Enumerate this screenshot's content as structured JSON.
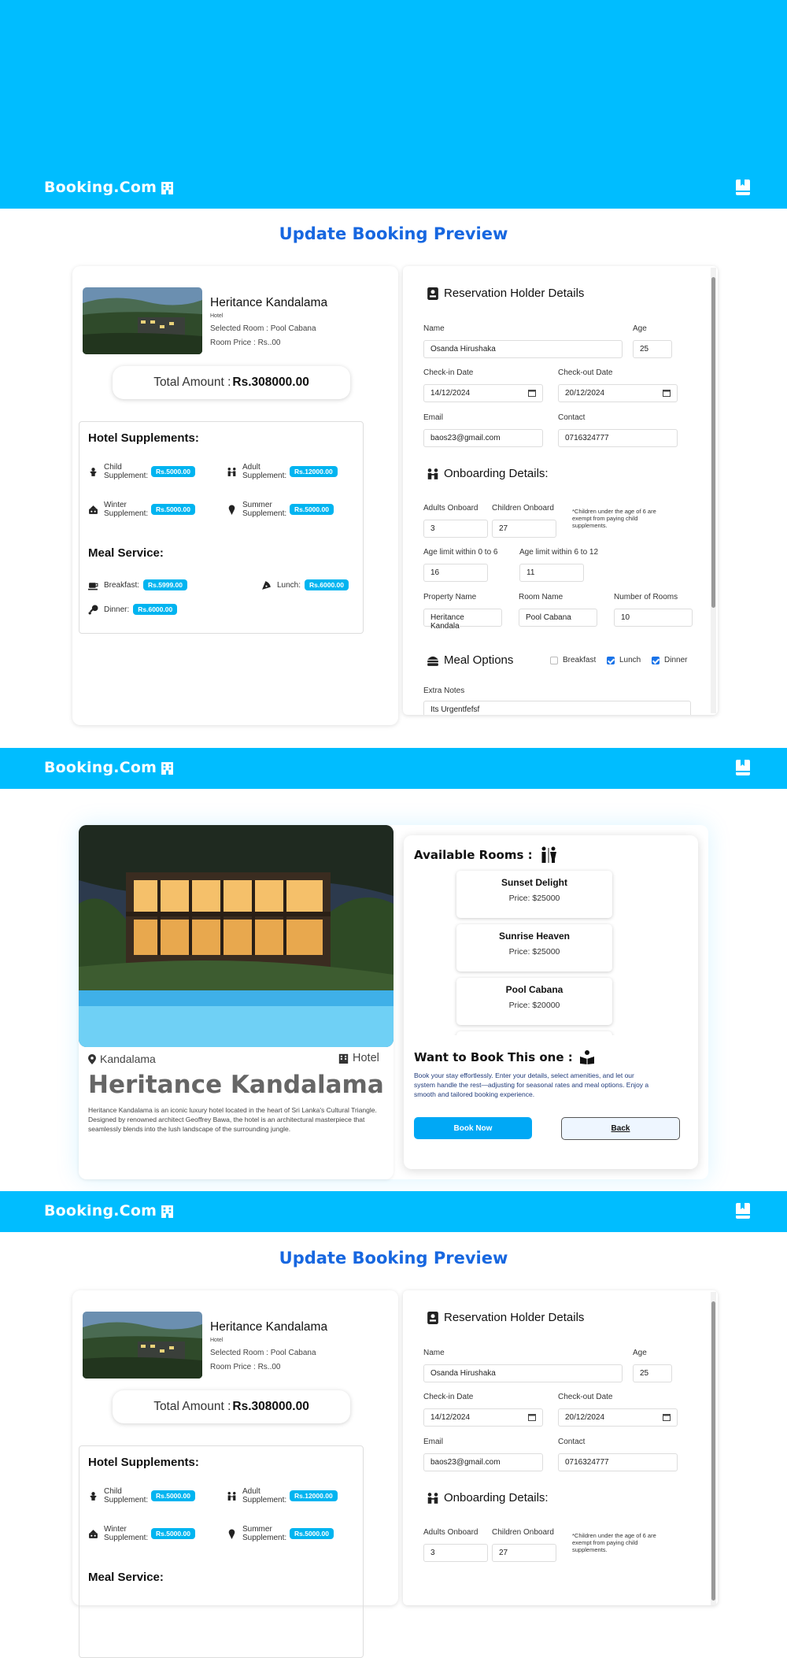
{
  "brand": "Booking.Com",
  "preview_title": "Update Booking Preview",
  "summary": {
    "hotel_name": "Heritance Kandalama",
    "hotel_type": "Hotel",
    "selected_room": "Selected Room : Pool Cabana",
    "room_price": "Room Price : Rs..00",
    "total_label": "Total Amount :",
    "total_value": "Rs.308000.00",
    "supplements_title": "Hotel Supplements:",
    "supplements": [
      {
        "label": "Child Supplement:",
        "price": "Rs.5000.00",
        "icon": "child-icon"
      },
      {
        "label": "Adult Supplement:",
        "price": "Rs.12000.00",
        "icon": "adults-icon"
      },
      {
        "label": "Winter Supplement:",
        "price": "Rs.5000.00",
        "icon": "snow-icon"
      },
      {
        "label": "Summer Supplement:",
        "price": "Rs.5000.00",
        "icon": "ice-cream-icon"
      }
    ],
    "meal_title": "Meal Service:",
    "meals": [
      {
        "label": "Breakfast:",
        "price": "Rs.5999.00",
        "icon": "coffee-icon"
      },
      {
        "label": "Lunch:",
        "price": "Rs.6000.00",
        "icon": "pizza-icon"
      },
      {
        "label": "Dinner:",
        "price": "Rs.6000.00",
        "icon": "drumstick-icon"
      }
    ]
  },
  "form": {
    "holder_title": "Reservation Holder Details",
    "name_label": "Name",
    "name_value": "Osanda Hirushaka",
    "age_label": "Age",
    "age_value": "25",
    "checkin_label": "Check-in Date",
    "checkin_value": "14/12/2024",
    "checkout_label": "Check-out Date",
    "checkout_value": "20/12/2024",
    "email_label": "Email",
    "email_value": "baos23@gmail.com",
    "contact_label": "Contact",
    "contact_value": "0716324777",
    "onboarding_title": "Onboarding Details:",
    "adults_label": "Adults Onboard",
    "adults_value": "3",
    "children_label": "Children Onboard",
    "children_value": "27",
    "children_note": "*Children under the age of 6 are exempt from paying child supplements.",
    "age06_label": "Age limit within 0 to 6",
    "age06_value": "16",
    "age612_label": "Age limit within 6 to 12",
    "age612_value": "11",
    "property_label": "Property Name",
    "property_value": "Heritance Kandala",
    "room_label": "Room Name",
    "room_value": "Pool Cabana",
    "rooms_label": "Number of Rooms",
    "rooms_value": "10",
    "meal_title": "Meal Options",
    "meal_breakfast": "Breakfast",
    "meal_breakfast_checked": false,
    "meal_lunch": "Lunch",
    "meal_lunch_checked": true,
    "meal_dinner": "Dinner",
    "meal_dinner_checked": true,
    "notes_label": "Extra Notes",
    "notes_value": "Its Urgentfefsf"
  },
  "detail": {
    "location": "Kandalama",
    "type": "Hotel",
    "name": "Heritance Kandalama",
    "description": "Heritance Kandalama is an iconic luxury hotel located in the heart of Sri Lanka's Cultural Triangle. Designed by renowned architect Geoffrey Bawa, the hotel is an architectural masterpiece that seamlessly blends into the lush landscape of the surrounding jungle.",
    "rooms_title": "Available Rooms :",
    "rooms": [
      {
        "name": "Sunset Delight",
        "price": "Price: $25000"
      },
      {
        "name": "Sunrise Heaven",
        "price": "Price: $25000"
      },
      {
        "name": "Pool Cabana",
        "price": "Price: $20000"
      }
    ],
    "book_title": "Want to Book This one :",
    "book_text": "Book your stay effortlessly. Enter your details, select amenities, and let our system handle the rest—adjusting for seasonal rates and meal options. Enjoy a smooth and tailored booking experience.",
    "book_button": "Book Now",
    "back_button": "Back"
  },
  "colors": {
    "brand": "#00bdff",
    "title": "#1767e0",
    "pill": "#00b4f0"
  }
}
